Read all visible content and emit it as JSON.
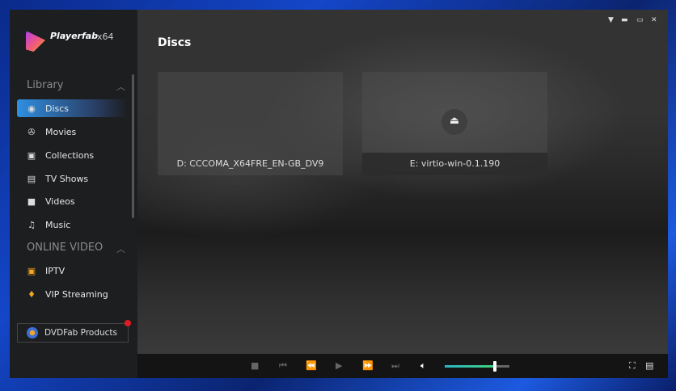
{
  "app": {
    "name": "Playerfab",
    "arch": "x64"
  },
  "sidebar": {
    "library_title": "Library",
    "library_items": [
      {
        "label": "Discs",
        "icon": "disc-icon"
      },
      {
        "label": "Movies",
        "icon": "film-reel-icon"
      },
      {
        "label": "Collections",
        "icon": "collection-icon"
      },
      {
        "label": "TV Shows",
        "icon": "tv-icon"
      },
      {
        "label": "Videos",
        "icon": "video-camera-icon"
      },
      {
        "label": "Music",
        "icon": "music-note-icon"
      }
    ],
    "online_title": "ONLINE VIDEO",
    "online_items": [
      {
        "label": "IPTV",
        "icon": "iptv-icon"
      },
      {
        "label": "VIP Streaming",
        "icon": "diamond-icon"
      }
    ],
    "products_label": "DVDFab Products"
  },
  "main": {
    "title": "Discs",
    "discs": [
      {
        "label": "D: CCCOMA_X64FRE_EN-GB_DV9"
      },
      {
        "label": "E: virtio-win-0.1.190"
      }
    ]
  },
  "player": {
    "volume_percent": 78,
    "accent_colors": [
      "#2bb5c8",
      "#3fd27a"
    ]
  }
}
